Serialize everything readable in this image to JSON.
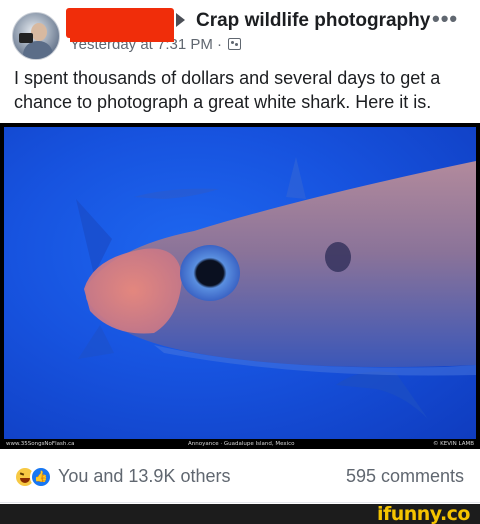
{
  "post": {
    "group_name": "Crap wildlife photography",
    "timestamp": "Yesterday at 7:31 PM ·",
    "text": "I spent thousands of dollars and several days to get a chance to photograph a great white shark.  Here it is.",
    "more_label": "•••"
  },
  "photo": {
    "caption_left": "www.35SongsNoFlash.ca",
    "caption_center": "Annoyance · Guadalupe Island, Mexico",
    "caption_right": "© KEVIN LAMB"
  },
  "reactions": {
    "icons": [
      "haha-reaction-icon",
      "like-reaction-icon"
    ],
    "summary": "You and 13.9K others",
    "comments": "595 comments"
  },
  "footer": {
    "brand": "ifunny.co"
  },
  "colors": {
    "accent": "#1877f2",
    "redaction": "#f02d0a",
    "water": "#1753df",
    "brand": "#f5c400"
  }
}
